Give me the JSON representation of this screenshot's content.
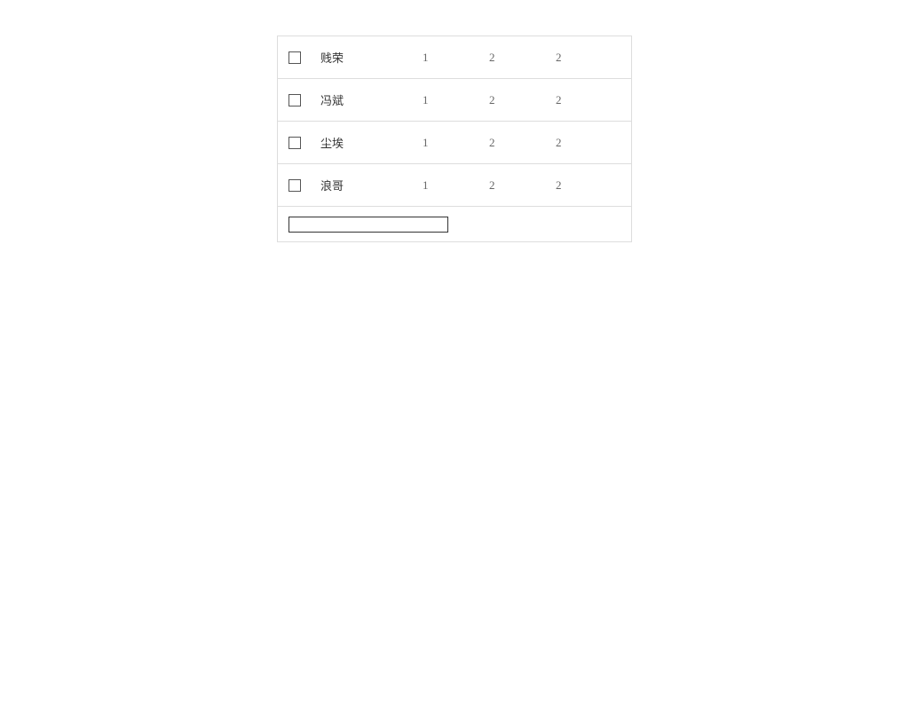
{
  "rows": [
    {
      "name": "贱荣",
      "c1": "1",
      "c2": "2",
      "c3": "2"
    },
    {
      "name": "冯斌",
      "c1": "1",
      "c2": "2",
      "c3": "2"
    },
    {
      "name": "尘埃",
      "c1": "1",
      "c2": "2",
      "c3": "2"
    },
    {
      "name": "浪哥",
      "c1": "1",
      "c2": "2",
      "c3": "2"
    }
  ],
  "input": {
    "value": ""
  }
}
